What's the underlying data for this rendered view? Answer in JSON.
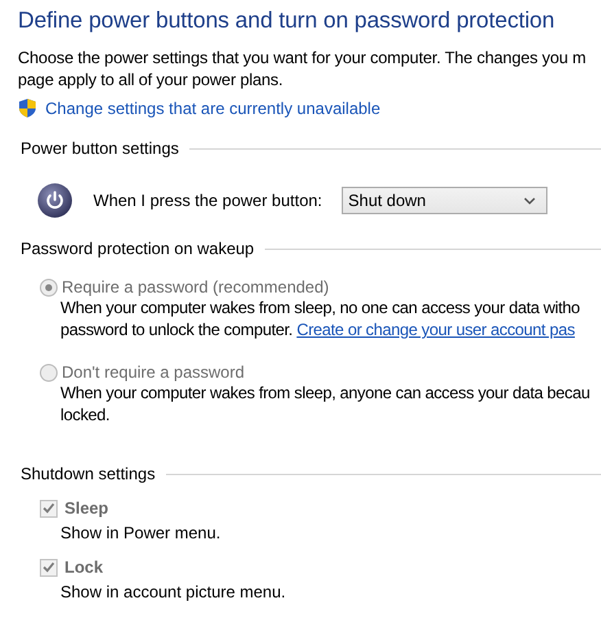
{
  "title": "Define power buttons and turn on password protection",
  "intro": [
    "Choose the power settings that you want for your computer. The changes you m",
    "page apply to all of your power plans."
  ],
  "elevate_link": "Change settings that are currently unavailable",
  "sections": [
    {
      "kind": "power",
      "heading": "Power button settings",
      "label": "When I press the power button:",
      "value": "Shut down"
    },
    {
      "kind": "radios",
      "heading": "Password protection on wakeup",
      "options": [
        {
          "label": "Require a password (recommended)",
          "selected": true,
          "disabled": true,
          "lines": [
            "When your computer wakes from sleep, no one can access your data witho",
            "password to unlock the computer. "
          ],
          "link": "Create or change your user account pas"
        },
        {
          "label": "Don't require a password",
          "selected": false,
          "disabled": true,
          "lines": [
            "When your computer wakes from sleep, anyone can access your data becau",
            "locked."
          ]
        }
      ]
    },
    {
      "kind": "checks",
      "heading": "Shutdown settings",
      "options": [
        {
          "label": "Sleep",
          "checked": true,
          "disabled": true,
          "desc": "Show in Power menu."
        },
        {
          "label": "Lock",
          "checked": true,
          "disabled": true,
          "desc": "Show in account picture menu."
        }
      ]
    }
  ]
}
